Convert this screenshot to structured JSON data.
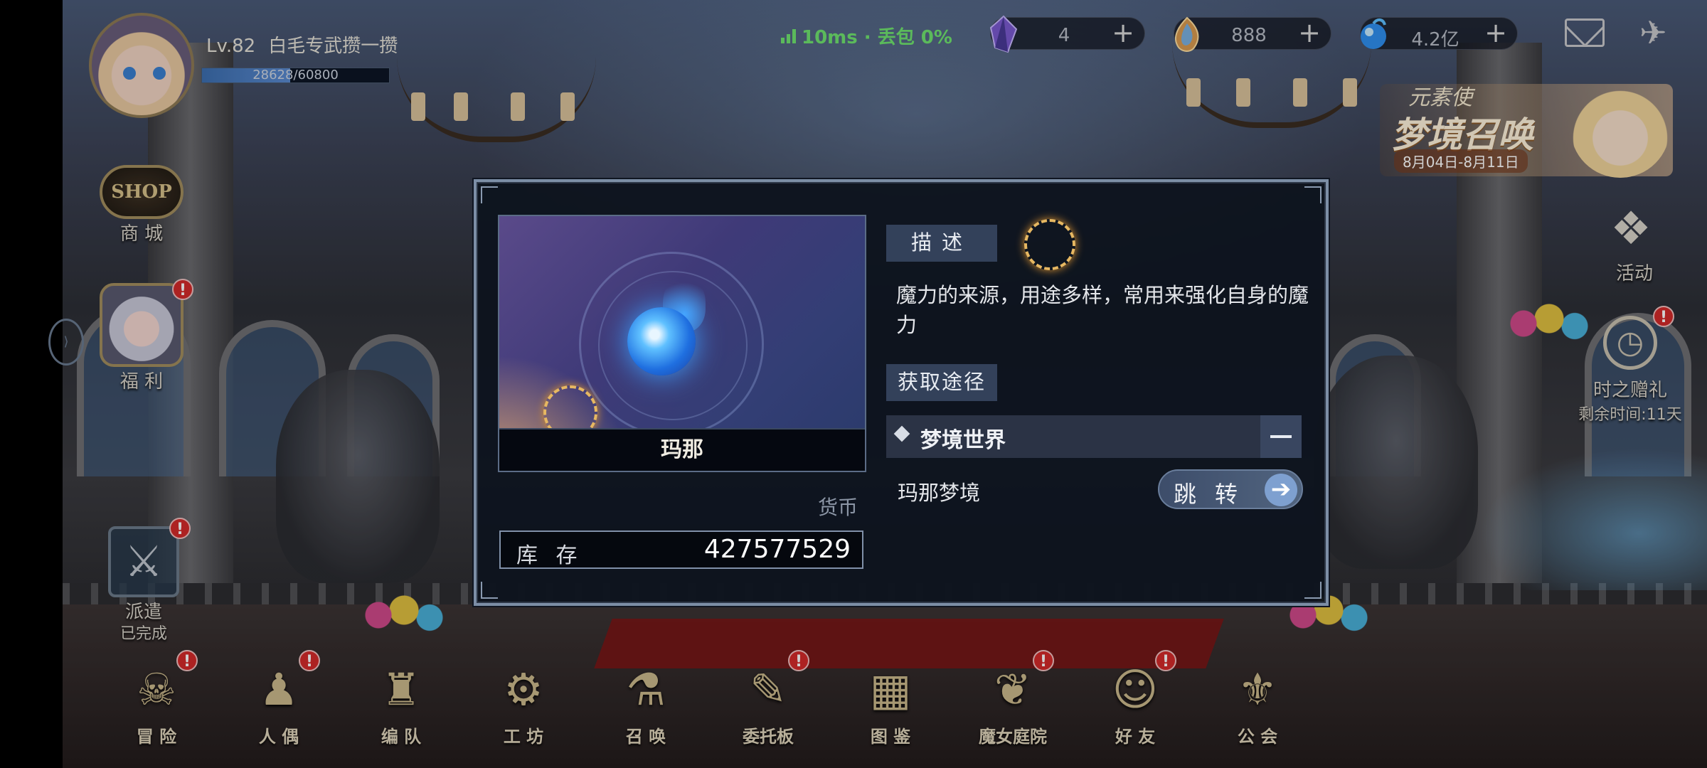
{
  "player": {
    "level": "Lv.82",
    "name": "白毛专武攒一攒",
    "exp_text": "28628/60800",
    "exp_fraction": 0.47
  },
  "network": {
    "status": "10ms · 丢包 0%"
  },
  "currencies": [
    {
      "icon": "purple-crystal-icon",
      "value": "4",
      "color": "#8a6ad8"
    },
    {
      "icon": "rainbow-gem-icon",
      "value": "888",
      "color": "#e0a050"
    },
    {
      "icon": "mana-orb-icon",
      "value": "4.2亿",
      "color": "#3a9aff"
    }
  ],
  "top_icons": {
    "mail": "mail-icon",
    "announce": "announcement-icon"
  },
  "banner": {
    "tag": "元素使",
    "title": "梦境召唤",
    "date": "8月04日-8月11日"
  },
  "left_side": {
    "shop_icon_text": "SHOP",
    "shop_label": "商 城",
    "welfare_label": "福 利",
    "dispatch_label": "派遣",
    "dispatch_status": "已完成",
    "badge": "!"
  },
  "right_side": {
    "activity_label": "活动",
    "timegift_label": "时之赠礼",
    "timegift_remaining": "剩余时间:11天"
  },
  "nav": [
    {
      "label": "冒 险",
      "icon": "adventure-mask-icon",
      "glyph": "☠",
      "badge": true
    },
    {
      "label": "人 偶",
      "icon": "dolls-icon",
      "glyph": "♟",
      "badge": true
    },
    {
      "label": "编 队",
      "icon": "formation-chess-icon",
      "glyph": "♜",
      "badge": false
    },
    {
      "label": "工 坊",
      "icon": "workshop-globe-icon",
      "glyph": "⚙",
      "badge": false
    },
    {
      "label": "召 唤",
      "icon": "summon-flask-icon",
      "glyph": "⚗",
      "badge": false
    },
    {
      "label": "委托板",
      "icon": "commission-scroll-icon",
      "glyph": "✎",
      "badge": true
    },
    {
      "label": "图 鉴",
      "icon": "codex-book-icon",
      "glyph": "▦",
      "badge": false
    },
    {
      "label": "魔女庭院",
      "icon": "witch-garden-icon",
      "glyph": "❦",
      "badge": true
    },
    {
      "label": "好 友",
      "icon": "friends-icon",
      "glyph": "☺",
      "badge": true
    },
    {
      "label": "公 会",
      "icon": "guild-crest-icon",
      "glyph": "⚜",
      "badge": false
    }
  ],
  "item": {
    "name": "玛那",
    "type": "货币",
    "stock_label": "库 存",
    "stock_value": "427577529",
    "desc_tag": "描述",
    "description": "魔力的来源，用途多样，常用来强化自身的魔力",
    "source_tag": "获取途径",
    "source_name": "梦境世界",
    "sub_source": "玛那梦境",
    "jump_label": "跳转",
    "jump_arrow": "➔"
  }
}
